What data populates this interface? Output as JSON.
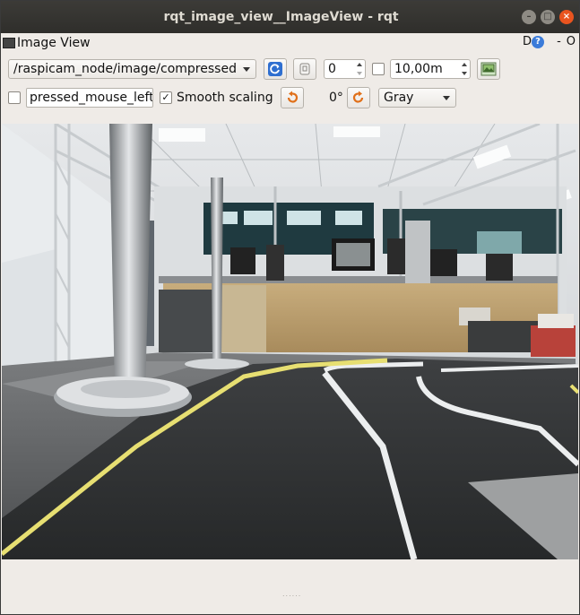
{
  "window": {
    "title": "rqt_image_view__ImageView - rqt"
  },
  "dock": {
    "title": "Image View",
    "d_label": "D",
    "help_label": "?",
    "dash_label": "-",
    "o_label": "O"
  },
  "toolbar": {
    "topic": "/raspicam_node/image/compressed",
    "refresh_icon": "refresh-icon",
    "zoom_icon": "zoom-fit-icon",
    "spin_value": "0",
    "max_depth_checked": false,
    "max_depth_value": "10,00m",
    "save_icon": "save-image-icon"
  },
  "row2": {
    "mouse_checked": false,
    "mouse_topic": "pressed_mouse_left",
    "smooth_checked": true,
    "smooth_label": "Smooth scaling",
    "rotate_left_icon": "rotate-left-icon",
    "rotation": "0°",
    "rotate_right_icon": "rotate-right-icon",
    "colormap": "Gray"
  },
  "colors": {
    "titlebar": "#3c3b37",
    "close_button": "#e9541f",
    "accent_refresh": "#2f6fd0",
    "accent_rotate": "#e0701a"
  }
}
